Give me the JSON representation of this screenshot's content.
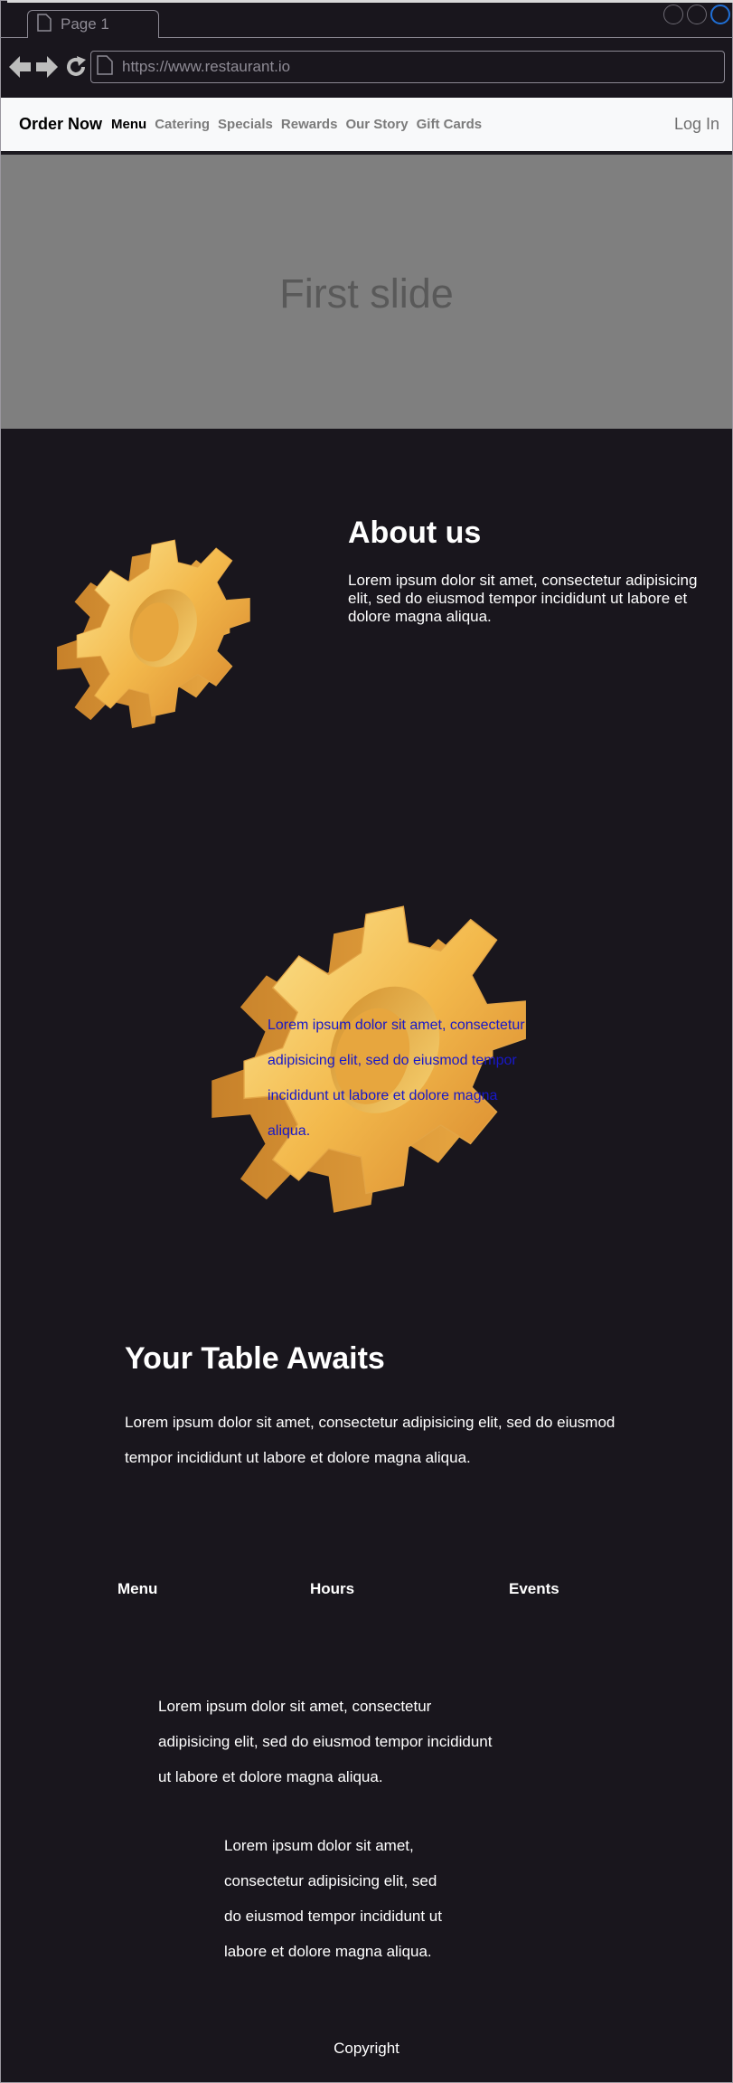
{
  "browser": {
    "tab_title": "Page 1",
    "url": "https://www.restaurant.io",
    "icons": [
      "page-icon",
      "back-icon",
      "forward-icon",
      "reload-icon"
    ]
  },
  "navbar": {
    "brand": "Order Now",
    "links": [
      "Menu",
      "Catering",
      "Specials",
      "Rewards",
      "Our Story",
      "Gift Cards"
    ],
    "active_link": "Menu",
    "login": "Log In"
  },
  "hero": {
    "slide_label": "First slide"
  },
  "about": {
    "title": "About us",
    "text": "Lorem ipsum dolor sit amet, consectetur adipisicing elit, sed do eiusmod tempor incididunt ut labore et dolore magna aliqua."
  },
  "feature": {
    "text": "Lorem ipsum dolor sit amet, consectetur adipisicing elit, sed do eiusmod tempor incididunt ut labore et dolore magna aliqua."
  },
  "cta": {
    "title": "Your Table Awaits",
    "text": "Lorem ipsum dolor sit amet, consectetur adipisicing elit, sed do eiusmod tempor incididunt ut labore et dolore magna aliqua."
  },
  "footer": {
    "columns": [
      "Menu",
      "Hours",
      "Events"
    ],
    "paragraph_1": "Lorem ipsum dolor sit amet, consectetur adipisicing elit, sed do eiusmod tempor incididunt ut labore et dolore magna aliqua.",
    "paragraph_2": "Lorem ipsum dolor sit amet, consectetur adipisicing elit, sed do eiusmod tempor incididunt ut labore et dolore magna aliqua.",
    "copyright": "Copyright"
  },
  "colors": {
    "page_bg": "#19161d",
    "navbar_bg": "#f8f9fa",
    "hero_bg": "#7f7f7f",
    "overlay_text": "#1818c9",
    "gear": "#f2b94a"
  }
}
